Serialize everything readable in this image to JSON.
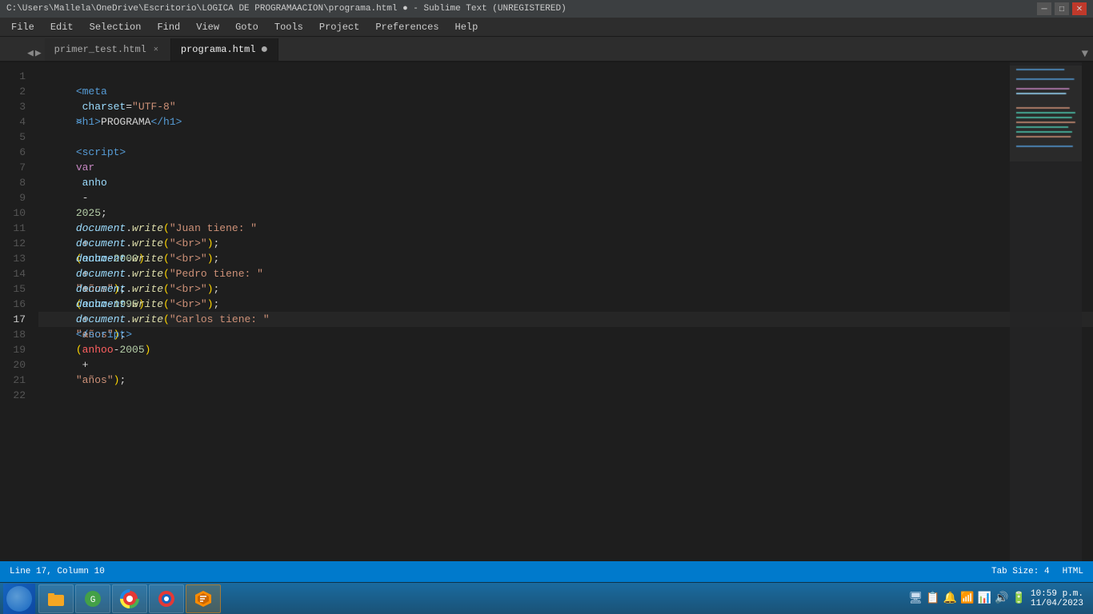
{
  "titlebar": {
    "path": "C:\\Users\\Mallela\\OneDrive\\Escritorio\\LOGICA DE PROGRAMAACION\\programa.html",
    "app": "Sublime Text (UNREGISTERED)"
  },
  "menubar": {
    "items": [
      "File",
      "Edit",
      "Selection",
      "Find",
      "View",
      "Goto",
      "Tools",
      "Project",
      "Preferences",
      "Help"
    ]
  },
  "tabs": [
    {
      "id": "tab1",
      "label": "primer_test.html",
      "active": false,
      "dirty": false
    },
    {
      "id": "tab2",
      "label": "programa.html",
      "active": true,
      "dirty": true
    }
  ],
  "editor": {
    "lines": 22,
    "current_line": 17,
    "current_col": 10
  },
  "statusbar": {
    "position": "Line 17, Column 10",
    "tab_size": "Tab Size: 4",
    "syntax": "HTML"
  },
  "taskbar": {
    "time": "10:59 p.m.",
    "date": "11/04/2023"
  }
}
